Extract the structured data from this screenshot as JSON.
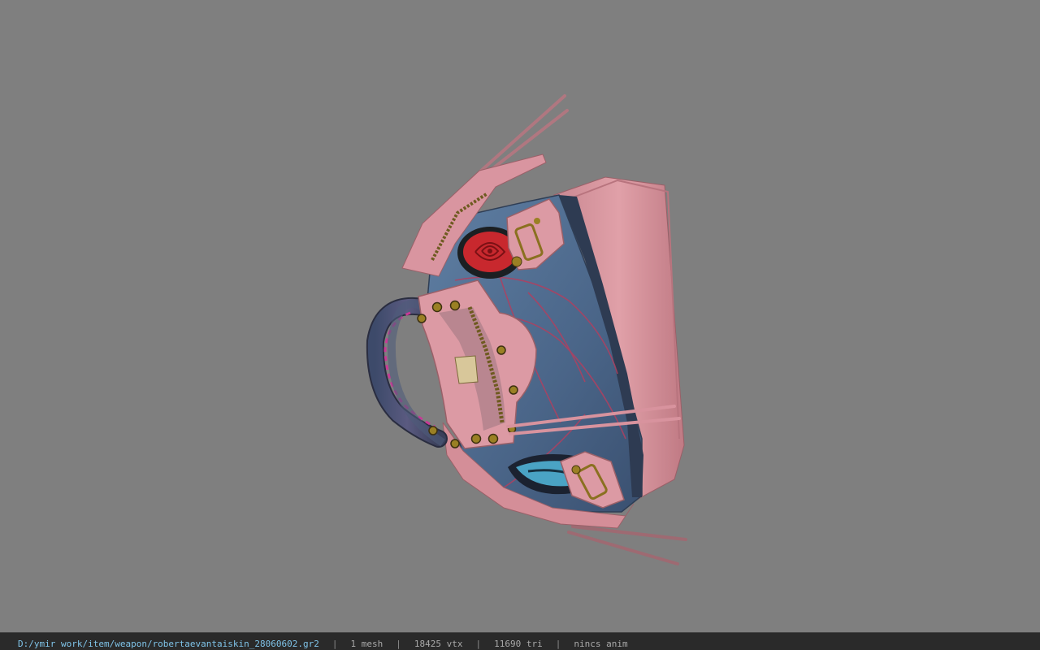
{
  "viewer": {
    "background": "#7f7f7f",
    "model_icon": "handbag-model"
  },
  "status": {
    "file_path": "D:/ymir work/item/weapon/robertaevantaiskin_28060602.gr2",
    "separator": "|",
    "mesh_count": "1 mesh",
    "vertex_count": "18425 vtx",
    "triangle_count": "11690 tri",
    "anim_status": "nincs anim"
  },
  "colors": {
    "pink": "#d88e98",
    "denim": "#4d6a8c",
    "rose": "#c8282e",
    "brass": "#b39a3a"
  }
}
